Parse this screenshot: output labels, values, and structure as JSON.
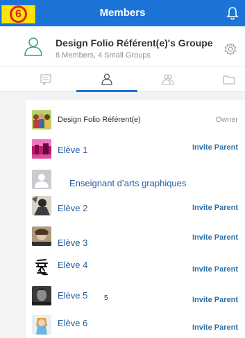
{
  "step_badge": "6",
  "header": {
    "title": "Members",
    "bell_icon": "bell-icon"
  },
  "group": {
    "name": "Design Folio Référent(e)'s Groupe",
    "meta": "8 Members, 4 Small Groups"
  },
  "tabs": [
    "chat-icon",
    "member-icon",
    "small-groups-icon",
    "folder-icon"
  ],
  "members": {
    "owner": {
      "name": "Design Folio Référent(e)",
      "role": "Owner"
    },
    "rows": [
      {
        "name": "Elève 1",
        "action": "Invite Parent"
      },
      {
        "name": "Enseignant d’arts graphiques"
      },
      {
        "name": "Elève 2",
        "action": "Invite Parent"
      },
      {
        "name": "Elève 3",
        "action": "Invite Parent"
      },
      {
        "name": "Elève 4",
        "action": "Invite Parent"
      },
      {
        "name": "Elève 5",
        "action": "Invite Parent",
        "stray": "5"
      },
      {
        "name": "Elève 6",
        "action": "Invite Parent"
      }
    ]
  },
  "colors": {
    "accent": "#1b74d6",
    "badge": "#ffe600",
    "badge_ring": "#e02020"
  }
}
